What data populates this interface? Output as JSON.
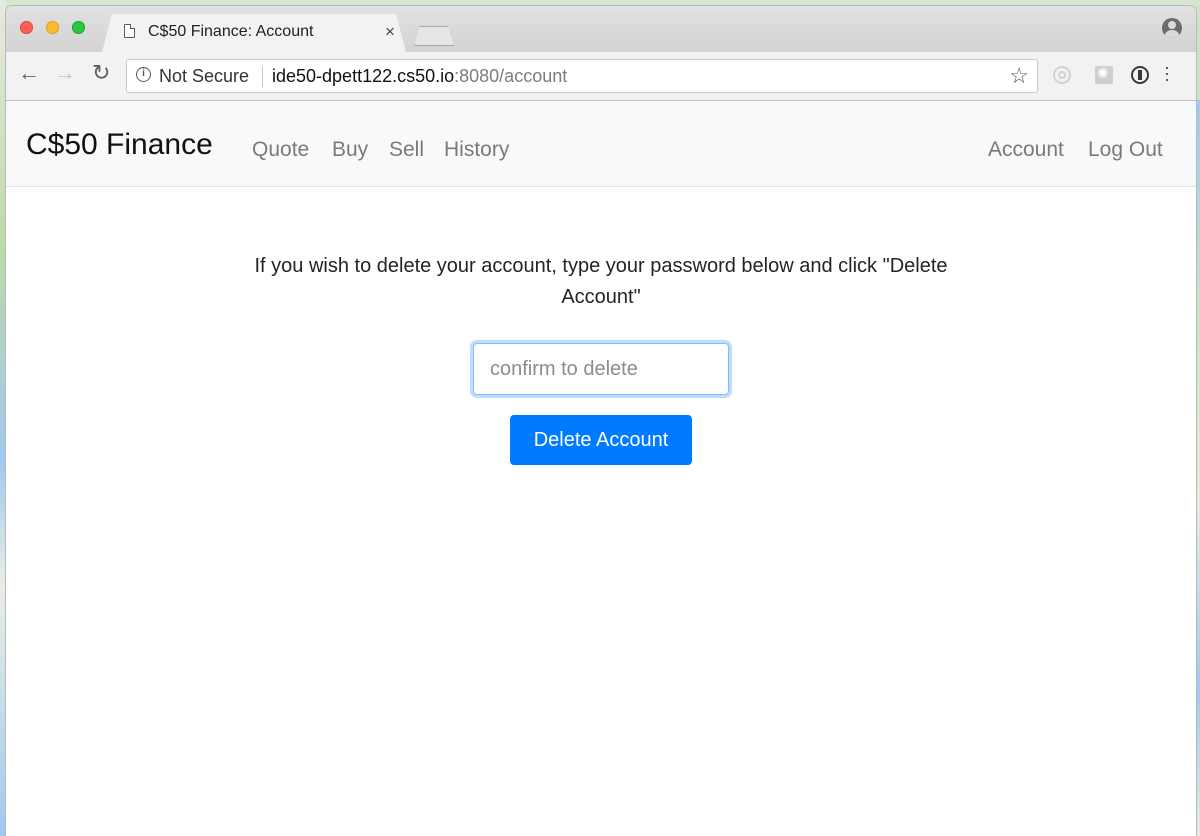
{
  "browser": {
    "tab_title": "C$50 Finance: Account",
    "tab_close": "×",
    "security_label": "Not Secure",
    "url_host": "ide50-dpett122.cs50.io",
    "url_rest": ":8080/account"
  },
  "navbar": {
    "brand": "C$50 Finance",
    "left_links": [
      "Quote",
      "Buy",
      "Sell",
      "History"
    ],
    "right_links": [
      "Account",
      "Log Out"
    ]
  },
  "main": {
    "instruction_line1": "If you wish to delete your account, type your password below and click \"Delete",
    "instruction_line2": "Account\"",
    "password_placeholder": "confirm to delete",
    "password_value": "",
    "delete_button_label": "Delete Account"
  },
  "colors": {
    "primary": "#007bff",
    "navbar_bg": "#f8f9fa"
  }
}
